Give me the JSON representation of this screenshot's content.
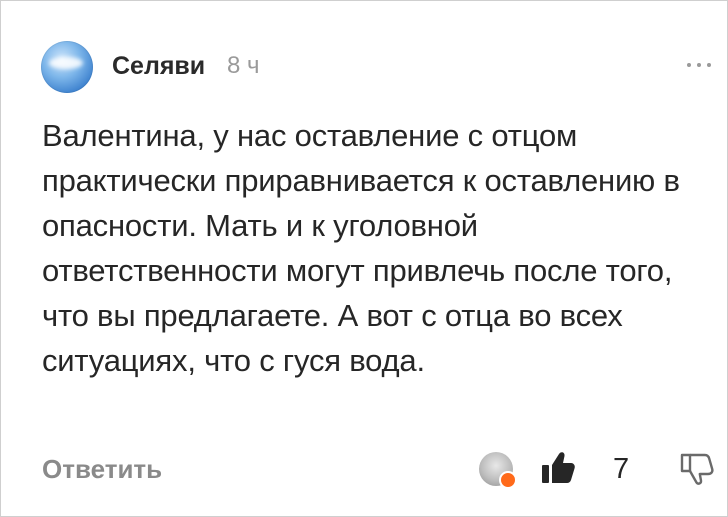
{
  "comment": {
    "author": "Селяви",
    "time": "8 ч",
    "text": "Валентина, у нас оставление с отцом практически приравнивается к оставлению в опасности. Мать и к уголовной ответственности могут привлечь после того, что вы предлагаете. А вот с отца во всех ситуациях, что с гуся вода.",
    "reply_label": "Ответить",
    "like_count": "7"
  },
  "icons": {
    "more": "more-horizontal-icon",
    "like": "thumbs-up-icon",
    "dislike": "thumbs-down-icon",
    "reaction": "heart-reaction-icon"
  },
  "colors": {
    "text": "#262626",
    "secondary": "#9a9a9a",
    "reaction": "#ff6a1a"
  }
}
